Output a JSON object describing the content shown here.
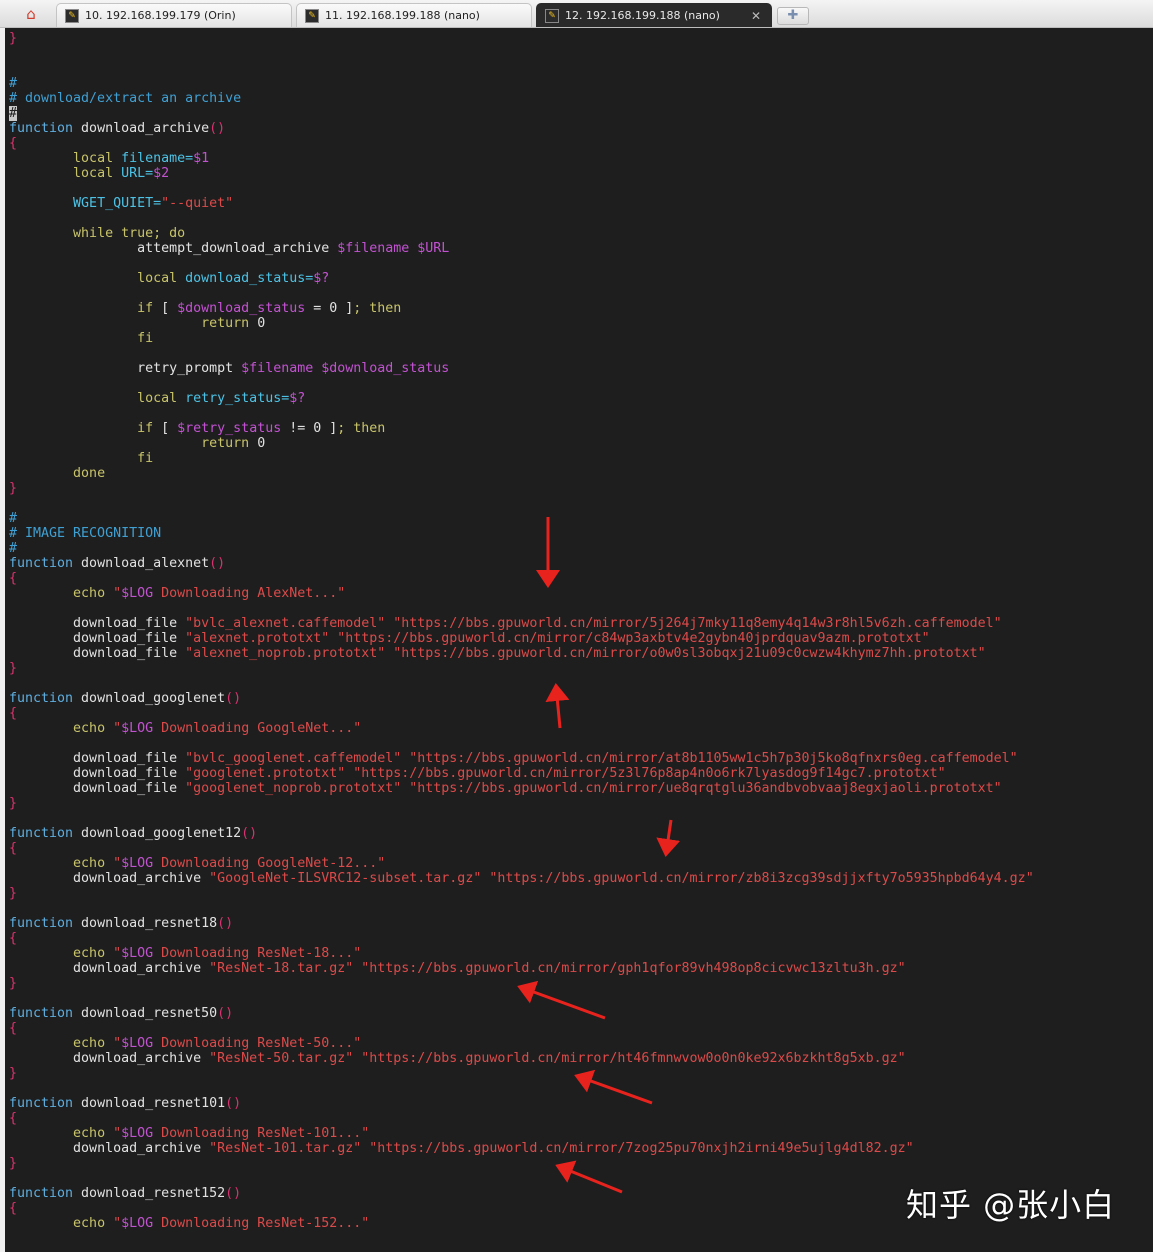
{
  "tabs": [
    {
      "label": "10. 192.168.199.179 (Orin)",
      "active": false
    },
    {
      "label": "11. 192.168.199.188 (nano)",
      "active": false
    },
    {
      "label": "12. 192.168.199.188 (nano)",
      "active": true
    }
  ],
  "icons": {
    "home": "home-icon",
    "tab": "putty-terminal-icon",
    "close": "close-icon",
    "new_tab": "plus-icon"
  },
  "colors": {
    "background": "#1e1e1e",
    "comment": "#3fa0d4",
    "string": "#dc4a4a",
    "keyword": "#c8c46a",
    "variable": "#c352d2",
    "annotation_arrow": "#e8231e"
  },
  "code_lines": [
    [
      [
        "p",
        "}"
      ]
    ],
    [],
    [],
    [
      [
        "c",
        "#"
      ]
    ],
    [
      [
        "c",
        "# download/extract an archive"
      ]
    ],
    [
      [
        "cur",
        "#"
      ]
    ],
    [
      [
        "k",
        "function"
      ],
      [
        "t",
        " download_archive"
      ],
      [
        "p",
        "()"
      ]
    ],
    [
      [
        "p",
        "{"
      ]
    ],
    [
      [
        "t",
        "\t"
      ],
      [
        "y",
        "local"
      ],
      [
        "t",
        " "
      ],
      [
        "n",
        "filename="
      ],
      [
        "v",
        "$1"
      ]
    ],
    [
      [
        "t",
        "\t"
      ],
      [
        "y",
        "local"
      ],
      [
        "t",
        " "
      ],
      [
        "n",
        "URL="
      ],
      [
        "v",
        "$2"
      ]
    ],
    [],
    [
      [
        "t",
        "\t"
      ],
      [
        "n",
        "WGET_QUIET="
      ],
      [
        "s",
        "\"--quiet\""
      ]
    ],
    [],
    [
      [
        "t",
        "\t"
      ],
      [
        "y",
        "while true; do"
      ]
    ],
    [
      [
        "t",
        "\t\tattempt_download_archive "
      ],
      [
        "v",
        "$filename $URL"
      ]
    ],
    [],
    [
      [
        "t",
        "\t\t"
      ],
      [
        "y",
        "local"
      ],
      [
        "t",
        " "
      ],
      [
        "n",
        "download_status="
      ],
      [
        "v",
        "$?"
      ]
    ],
    [],
    [
      [
        "t",
        "\t\t"
      ],
      [
        "y",
        "if"
      ],
      [
        "t",
        " [ "
      ],
      [
        "v",
        "$download_status"
      ],
      [
        "t",
        " = 0 ]"
      ],
      [
        "y",
        "; then"
      ]
    ],
    [
      [
        "t",
        "\t\t\t"
      ],
      [
        "y",
        "return"
      ],
      [
        "t",
        " 0"
      ]
    ],
    [
      [
        "t",
        "\t\t"
      ],
      [
        "y",
        "fi"
      ]
    ],
    [],
    [
      [
        "t",
        "\t\tretry_prompt "
      ],
      [
        "v",
        "$filename $download_status"
      ]
    ],
    [],
    [
      [
        "t",
        "\t\t"
      ],
      [
        "y",
        "local"
      ],
      [
        "t",
        " "
      ],
      [
        "n",
        "retry_status="
      ],
      [
        "v",
        "$?"
      ]
    ],
    [],
    [
      [
        "t",
        "\t\t"
      ],
      [
        "y",
        "if"
      ],
      [
        "t",
        " [ "
      ],
      [
        "v",
        "$retry_status"
      ],
      [
        "t",
        " != 0 ]"
      ],
      [
        "y",
        "; then"
      ]
    ],
    [
      [
        "t",
        "\t\t\t"
      ],
      [
        "y",
        "return"
      ],
      [
        "t",
        " 0"
      ]
    ],
    [
      [
        "t",
        "\t\t"
      ],
      [
        "y",
        "fi"
      ]
    ],
    [
      [
        "t",
        "\t"
      ],
      [
        "y",
        "done"
      ]
    ],
    [
      [
        "p",
        "}"
      ]
    ],
    [],
    [
      [
        "c",
        "#"
      ]
    ],
    [
      [
        "c",
        "# IMAGE RECOGNITION"
      ]
    ],
    [
      [
        "c",
        "#"
      ]
    ],
    [
      [
        "k",
        "function"
      ],
      [
        "t",
        " download_alexnet"
      ],
      [
        "p",
        "()"
      ]
    ],
    [
      [
        "p",
        "{"
      ]
    ],
    [
      [
        "t",
        "\t"
      ],
      [
        "y",
        "echo"
      ],
      [
        "t",
        " "
      ],
      [
        "s",
        "\""
      ],
      [
        "v",
        "$LOG"
      ],
      [
        "s",
        " Downloading AlexNet...\""
      ]
    ],
    [],
    [
      [
        "t",
        "\tdownload_file "
      ],
      [
        "s",
        "\"bvlc_alexnet.caffemodel\" \"https://bbs.gpuworld.cn/mirror/5j264j7mky11q8emy4q14w3r8hl5v6zh.caffemodel\""
      ]
    ],
    [
      [
        "t",
        "\tdownload_file "
      ],
      [
        "s",
        "\"alexnet.prototxt\" \"https://bbs.gpuworld.cn/mirror/c84wp3axbtv4e2gybn40jprdquav9azm.prototxt\""
      ]
    ],
    [
      [
        "t",
        "\tdownload_file "
      ],
      [
        "s",
        "\"alexnet_noprob.prototxt\" \"https://bbs.gpuworld.cn/mirror/o0w0sl3obqxj21u09c0cwzw4khymz7hh.prototxt\""
      ]
    ],
    [
      [
        "p",
        "}"
      ]
    ],
    [],
    [
      [
        "k",
        "function"
      ],
      [
        "t",
        " download_googlenet"
      ],
      [
        "p",
        "()"
      ]
    ],
    [
      [
        "p",
        "{"
      ]
    ],
    [
      [
        "t",
        "\t"
      ],
      [
        "y",
        "echo"
      ],
      [
        "t",
        " "
      ],
      [
        "s",
        "\""
      ],
      [
        "v",
        "$LOG"
      ],
      [
        "s",
        " Downloading GoogleNet...\""
      ]
    ],
    [],
    [
      [
        "t",
        "\tdownload_file "
      ],
      [
        "s",
        "\"bvlc_googlenet.caffemodel\" \"https://bbs.gpuworld.cn/mirror/at8b1105ww1c5h7p30j5ko8qfnxrs0eg.caffemodel\""
      ]
    ],
    [
      [
        "t",
        "\tdownload_file "
      ],
      [
        "s",
        "\"googlenet.prototxt\" \"https://bbs.gpuworld.cn/mirror/5z3l76p8ap4n0o6rk7lyasdog9f14gc7.prototxt\""
      ]
    ],
    [
      [
        "t",
        "\tdownload_file "
      ],
      [
        "s",
        "\"googlenet_noprob.prototxt\" \"https://bbs.gpuworld.cn/mirror/ue8qrqtglu36andbvobvaaj8egxjaoli.prototxt\""
      ]
    ],
    [
      [
        "p",
        "}"
      ]
    ],
    [],
    [
      [
        "k",
        "function"
      ],
      [
        "t",
        " download_googlenet12"
      ],
      [
        "p",
        "()"
      ]
    ],
    [
      [
        "p",
        "{"
      ]
    ],
    [
      [
        "t",
        "\t"
      ],
      [
        "y",
        "echo"
      ],
      [
        "t",
        " "
      ],
      [
        "s",
        "\""
      ],
      [
        "v",
        "$LOG"
      ],
      [
        "s",
        " Downloading GoogleNet-12...\""
      ]
    ],
    [
      [
        "t",
        "\tdownload_archive "
      ],
      [
        "s",
        "\"GoogleNet-ILSVRC12-subset.tar.gz\" \"https://bbs.gpuworld.cn/mirror/zb8i3zcg39sdjjxfty7o5935hpbd64y4.gz\""
      ]
    ],
    [
      [
        "p",
        "}"
      ]
    ],
    [],
    [
      [
        "k",
        "function"
      ],
      [
        "t",
        " download_resnet18"
      ],
      [
        "p",
        "()"
      ]
    ],
    [
      [
        "p",
        "{"
      ]
    ],
    [
      [
        "t",
        "\t"
      ],
      [
        "y",
        "echo"
      ],
      [
        "t",
        " "
      ],
      [
        "s",
        "\""
      ],
      [
        "v",
        "$LOG"
      ],
      [
        "s",
        " Downloading ResNet-18...\""
      ]
    ],
    [
      [
        "t",
        "\tdownload_archive "
      ],
      [
        "s",
        "\"ResNet-18.tar.gz\" \"https://bbs.gpuworld.cn/mirror/gph1qfor89vh498op8cicvwc13zltu3h.gz\""
      ]
    ],
    [
      [
        "p",
        "}"
      ]
    ],
    [],
    [
      [
        "k",
        "function"
      ],
      [
        "t",
        " download_resnet50"
      ],
      [
        "p",
        "()"
      ]
    ],
    [
      [
        "p",
        "{"
      ]
    ],
    [
      [
        "t",
        "\t"
      ],
      [
        "y",
        "echo"
      ],
      [
        "t",
        " "
      ],
      [
        "s",
        "\""
      ],
      [
        "v",
        "$LOG"
      ],
      [
        "s",
        " Downloading ResNet-50...\""
      ]
    ],
    [
      [
        "t",
        "\tdownload_archive "
      ],
      [
        "s",
        "\"ResNet-50.tar.gz\" \"https://bbs.gpuworld.cn/mirror/ht46fmnwvow0o0n0ke92x6bzkht8g5xb.gz\""
      ]
    ],
    [
      [
        "p",
        "}"
      ]
    ],
    [],
    [
      [
        "k",
        "function"
      ],
      [
        "t",
        " download_resnet101"
      ],
      [
        "p",
        "()"
      ]
    ],
    [
      [
        "p",
        "{"
      ]
    ],
    [
      [
        "t",
        "\t"
      ],
      [
        "y",
        "echo"
      ],
      [
        "t",
        " "
      ],
      [
        "s",
        "\""
      ],
      [
        "v",
        "$LOG"
      ],
      [
        "s",
        " Downloading ResNet-101...\""
      ]
    ],
    [
      [
        "t",
        "\tdownload_archive "
      ],
      [
        "s",
        "\"ResNet-101.tar.gz\" \"https://bbs.gpuworld.cn/mirror/7zog25pu70nxjh2irni49e5ujlg4dl82.gz\""
      ]
    ],
    [
      [
        "p",
        "}"
      ]
    ],
    [],
    [
      [
        "k",
        "function"
      ],
      [
        "t",
        " download_resnet152"
      ],
      [
        "p",
        "()"
      ]
    ],
    [
      [
        "p",
        "{"
      ]
    ],
    [
      [
        "t",
        "\t"
      ],
      [
        "y",
        "echo"
      ],
      [
        "t",
        " "
      ],
      [
        "s",
        "\""
      ],
      [
        "v",
        "$LOG"
      ],
      [
        "s",
        " Downloading ResNet-152...\""
      ]
    ]
  ],
  "watermark": "知乎 @张小白"
}
